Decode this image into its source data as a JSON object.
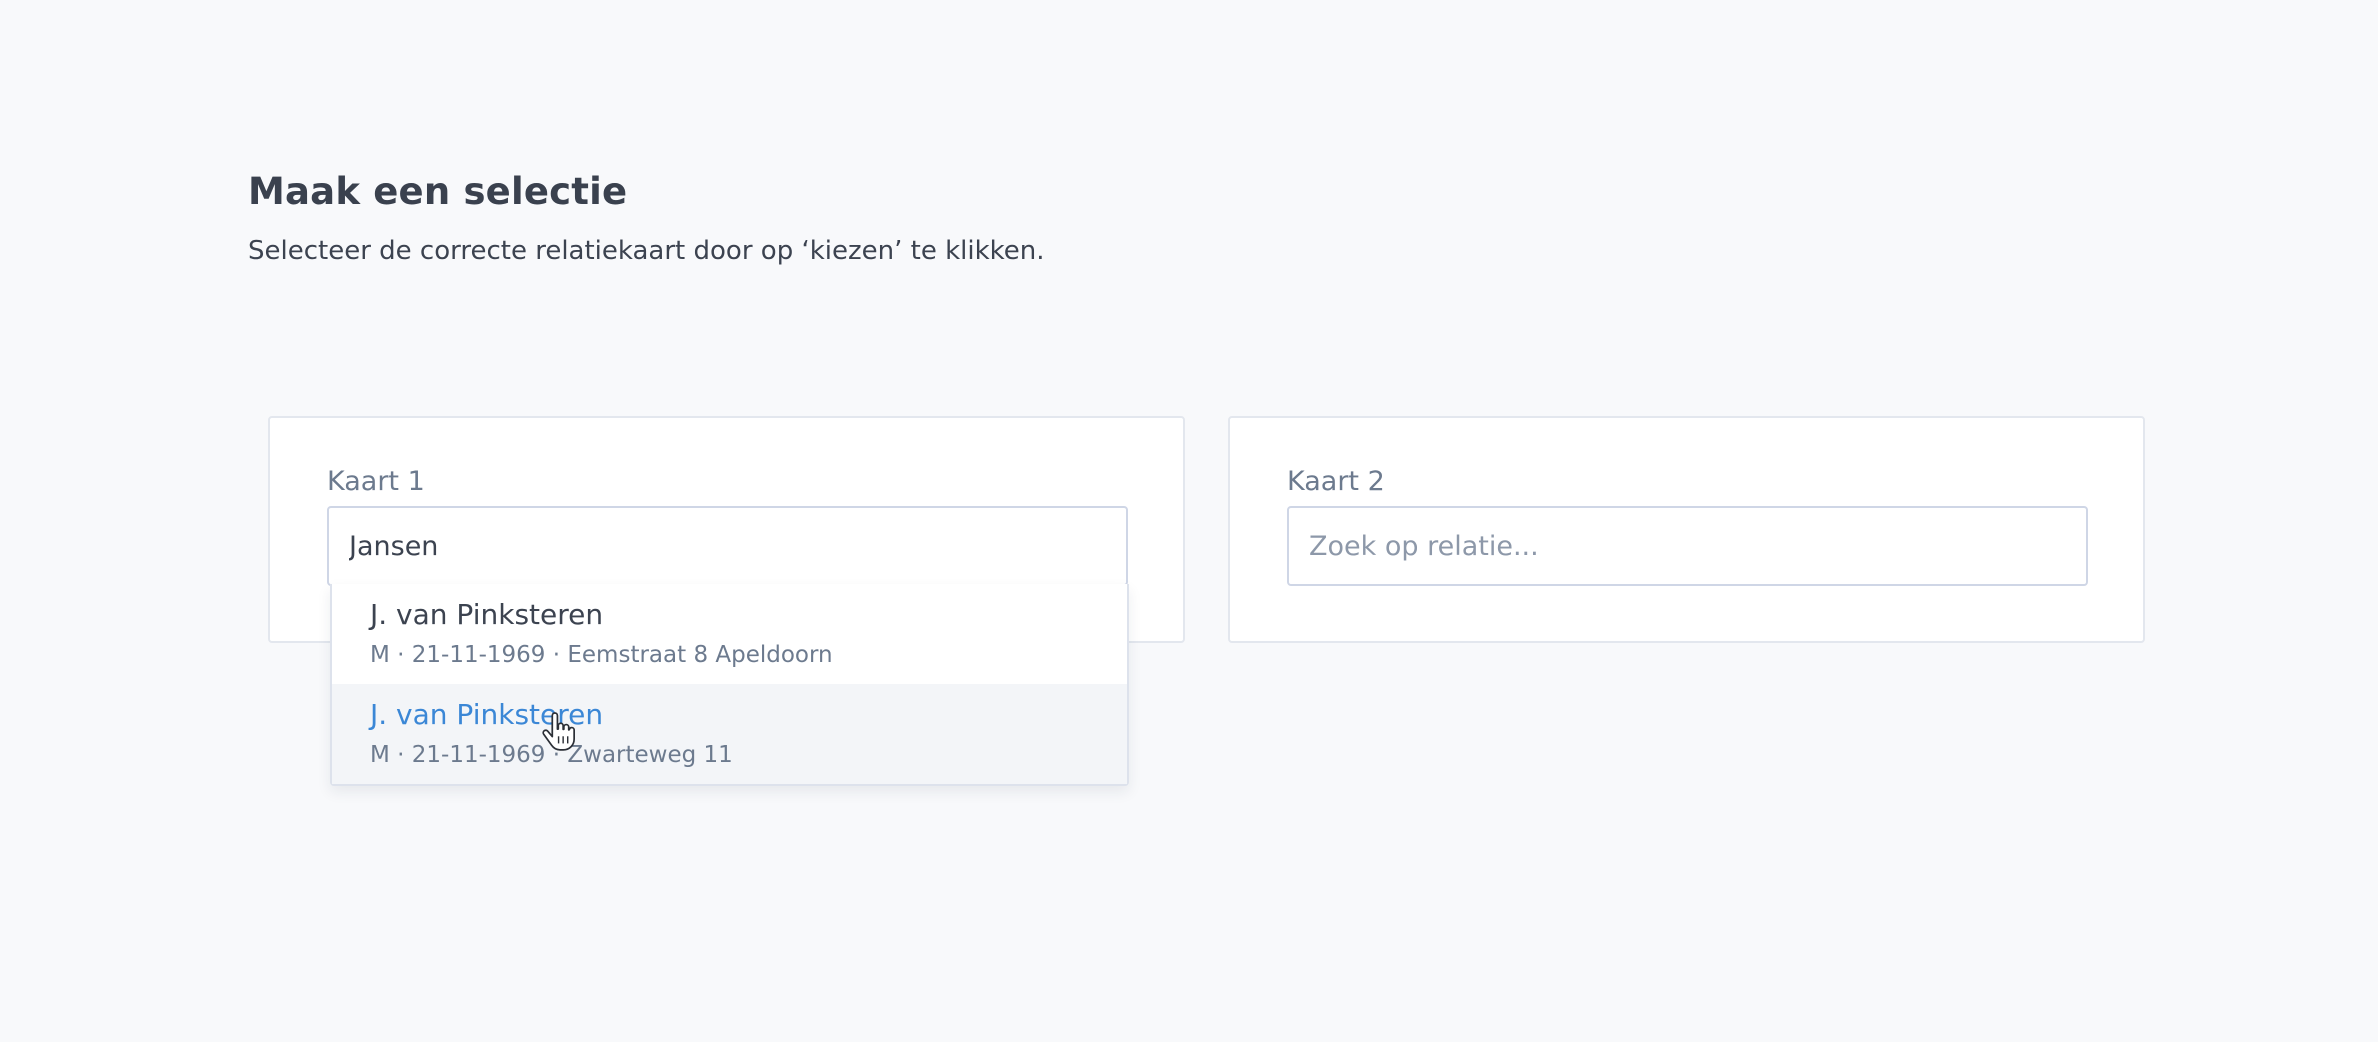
{
  "header": {
    "title": "Maak een selectie",
    "subtitle": "Selecteer de correcte relatiekaart door op ‘kiezen’ te klikken."
  },
  "cards": [
    {
      "label": "Kaart 1",
      "input_value": "Jansen",
      "placeholder": ""
    },
    {
      "label": "Kaart 2",
      "input_value": "",
      "placeholder": "Zoek op relatie..."
    }
  ],
  "dropdown": {
    "options": [
      {
        "name": "J. van Pinksteren",
        "detail": "M · 21-11-1969 · Eemstraat 8 Apeldoorn",
        "highlighted": false
      },
      {
        "name": "J. van Pinksteren",
        "detail": "M · 21-11-1969 · Zwarteweg 11",
        "highlighted": true
      }
    ]
  },
  "colors": {
    "background": "#f8f9fb",
    "accent": "#3b87d6",
    "text": "#3c4350",
    "muted": "#6c7a8e"
  },
  "icons": {
    "cursor": "hand-pointer-icon"
  }
}
